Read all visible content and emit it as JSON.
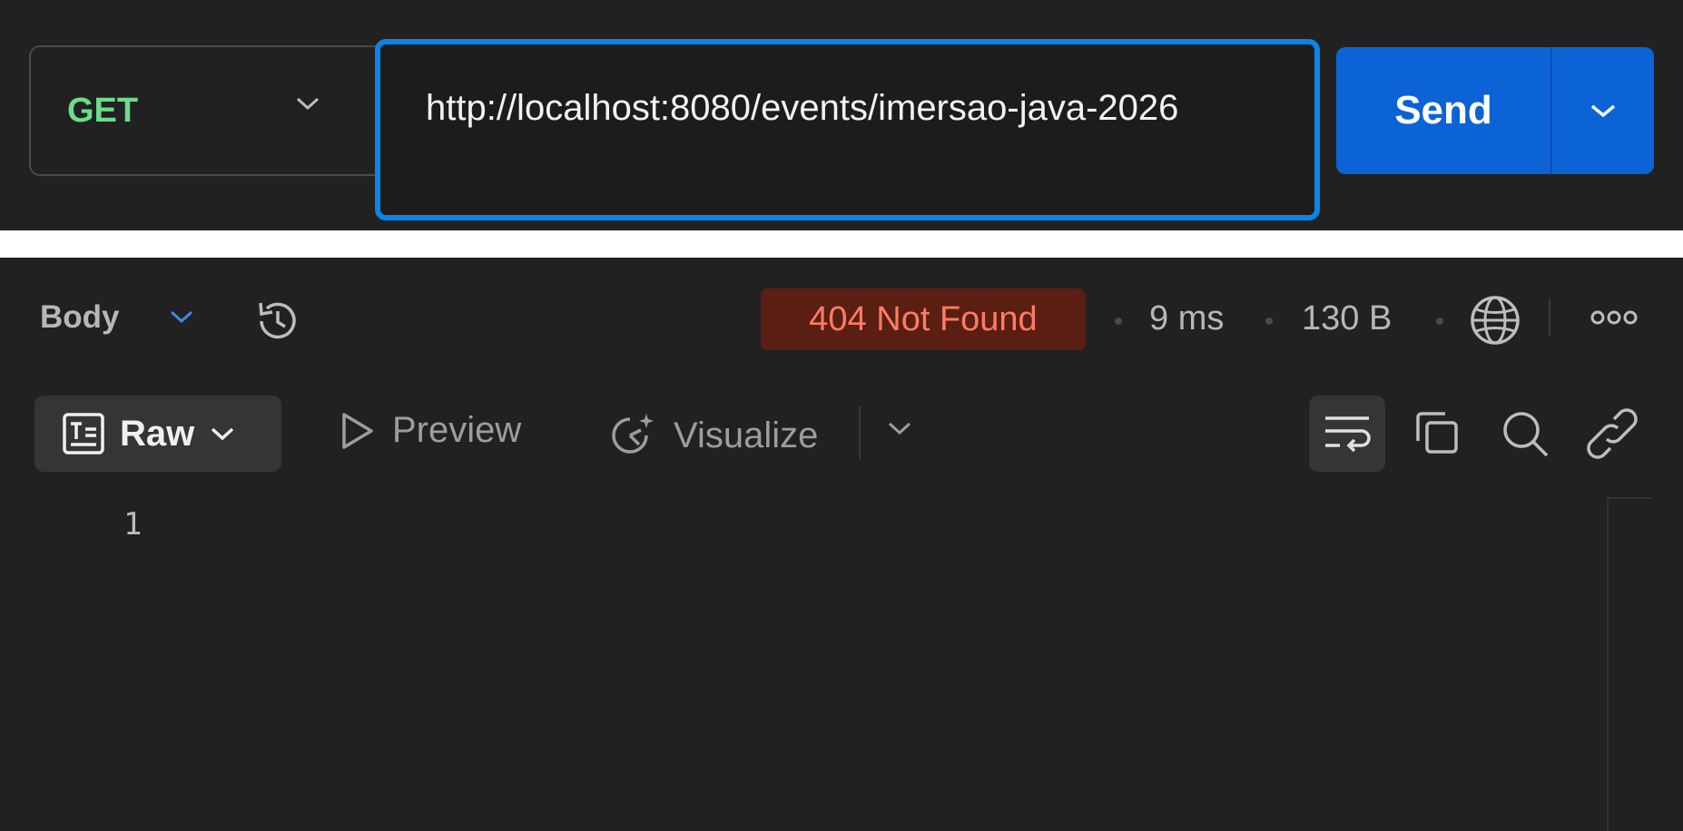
{
  "request": {
    "method": "GET",
    "url": "http://localhost:8080/events/imersao-java-2026",
    "send_label": "Send"
  },
  "response": {
    "body_label": "Body",
    "status": "404 Not Found",
    "time": "9 ms",
    "size": "130 B"
  },
  "toolbar": {
    "raw_label": "Raw",
    "preview_label": "Preview",
    "visualize_label": "Visualize"
  },
  "editor": {
    "line_number": "1"
  },
  "colors": {
    "accent": "#0b63d6",
    "focus_border": "#0a84e8",
    "method_green": "#6bdd8b",
    "status_error_bg": "#5a1f12",
    "status_error_text": "#ff7b63"
  },
  "icons": [
    "chevron-down-icon",
    "history-icon",
    "globe-icon",
    "more-icon",
    "raw-text-icon",
    "play-icon",
    "visualize-icon",
    "wrap-lines-icon",
    "copy-icon",
    "search-icon",
    "link-icon"
  ]
}
